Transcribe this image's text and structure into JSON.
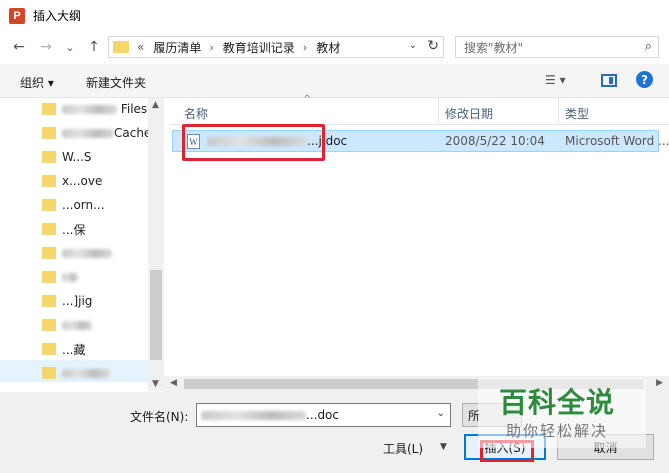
{
  "window": {
    "title": "插入大纲",
    "app_icon": "P"
  },
  "nav": {
    "back_icon": "←",
    "forward_icon": "→",
    "recent_icon": "⌄",
    "up_icon": "↑",
    "breadcrumb": [
      "«",
      "履历清单",
      "教育培训记录",
      "教材"
    ],
    "refresh_icon": "↻",
    "search_placeholder": "搜索\"教材\""
  },
  "toolbar": {
    "organize": "组织 ▾",
    "new_folder": "新建文件夹",
    "view_icon": "☰ ▾",
    "help": "?"
  },
  "sidebar": {
    "items": [
      {
        "visible_text": "Files"
      },
      {
        "visible_text": "Cache"
      },
      {
        "visible_text": "W...S"
      },
      {
        "visible_text": "x...ove"
      },
      {
        "visible_text": "...orn..."
      },
      {
        "visible_text": "...保"
      },
      {
        "visible_text": ""
      },
      {
        "visible_text": ""
      },
      {
        "visible_text": "...]jig"
      },
      {
        "visible_text": ""
      },
      {
        "visible_text": "...藏"
      },
      {
        "visible_text": ""
      }
    ]
  },
  "file_list": {
    "columns": {
      "name": "名称",
      "date": "修改日期",
      "type": "类型"
    },
    "rows": [
      {
        "name": "...j.doc",
        "date": "2008/5/22 10:04",
        "type": "Microsoft Word ..."
      }
    ]
  },
  "bottom": {
    "filename_label": "文件名(N):",
    "filename_value": "...doc",
    "filetype_button": "所",
    "tools_label": "工具(L)",
    "insert_button": "插入(S)",
    "cancel_button": "取消"
  },
  "watermark": {
    "title": "百科全说",
    "subtitle": "助你轻松解决"
  },
  "colors": {
    "accent": "#0078d7",
    "selection": "#cce8ff",
    "highlight": "#e0242f",
    "watermark_green": "#2e8b3e"
  }
}
